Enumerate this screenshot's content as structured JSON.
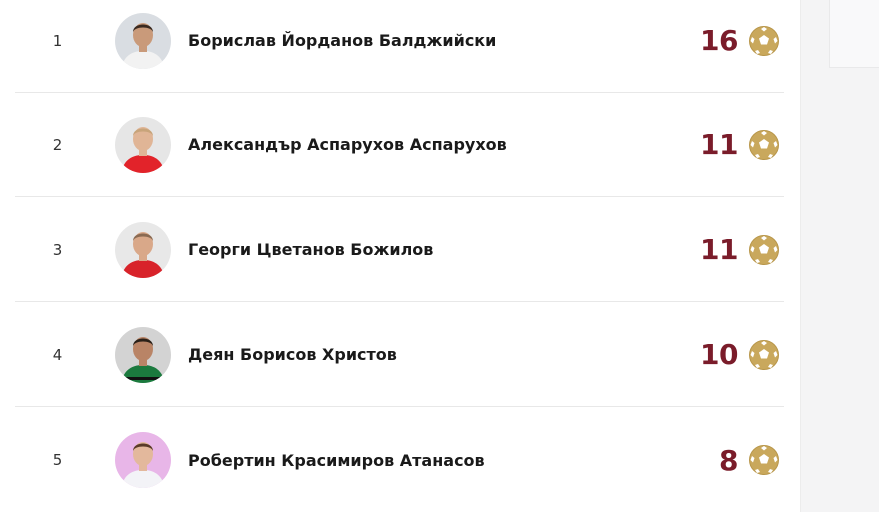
{
  "colors": {
    "goals": "#7a1c2a",
    "ball": "#c9a85c"
  },
  "scorers": [
    {
      "rank": "1",
      "name": "Борислав Йорданов Балджийски",
      "goals": "16",
      "shirt": "#f2f2f2",
      "bg": "#d9dde2",
      "icon": "football-icon"
    },
    {
      "rank": "2",
      "name": "Александър Аспарухов Аспарухов",
      "goals": "11",
      "shirt": "#e2232a",
      "bg": "#e6e6e6",
      "icon": "football-icon"
    },
    {
      "rank": "3",
      "name": "Георги Цветанов Божилов",
      "goals": "11",
      "shirt": "#d8232a",
      "bg": "#e8e8e8",
      "icon": "football-icon"
    },
    {
      "rank": "4",
      "name": "Деян Борисов Христов",
      "goals": "10",
      "shirt": "#1b7a3e",
      "bg": "#d3d3d3",
      "icon": "football-icon"
    },
    {
      "rank": "5",
      "name": "Робертин Красимиров Атанасов",
      "goals": "8",
      "shirt": "#f3f3f7",
      "bg": "#e8b6e8",
      "icon": "football-icon"
    }
  ]
}
